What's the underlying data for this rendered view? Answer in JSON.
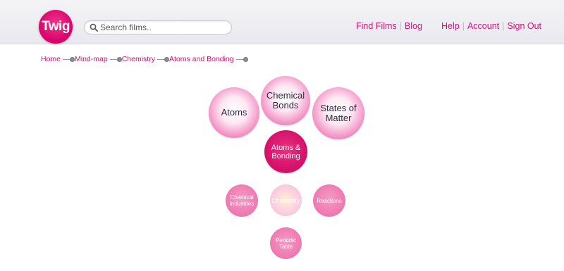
{
  "logo": {
    "text": "Twig"
  },
  "search": {
    "placeholder": "Search films.."
  },
  "nav": {
    "left": [
      "Find Films",
      "Blog"
    ],
    "right": [
      "Help",
      "Account",
      "Sign Out"
    ]
  },
  "breadcrumb": [
    "Home",
    "Mind-map",
    "Chemistry",
    "Atoms and Bonding"
  ],
  "mindmap": {
    "parents": [
      {
        "label": "Atoms"
      },
      {
        "label": "Chemical Bonds"
      },
      {
        "label": "States of Matter"
      }
    ],
    "current": {
      "label": "Atoms & Bonding"
    },
    "related": [
      {
        "label": "Chemical Industries"
      },
      {
        "label": "Chemistry"
      },
      {
        "label": "Reactions"
      },
      {
        "label": "Periodic Table"
      }
    ]
  },
  "colors": {
    "brand": "#d6006e",
    "accent_text": "#c6166f",
    "header_bg": "#eeeef3"
  }
}
